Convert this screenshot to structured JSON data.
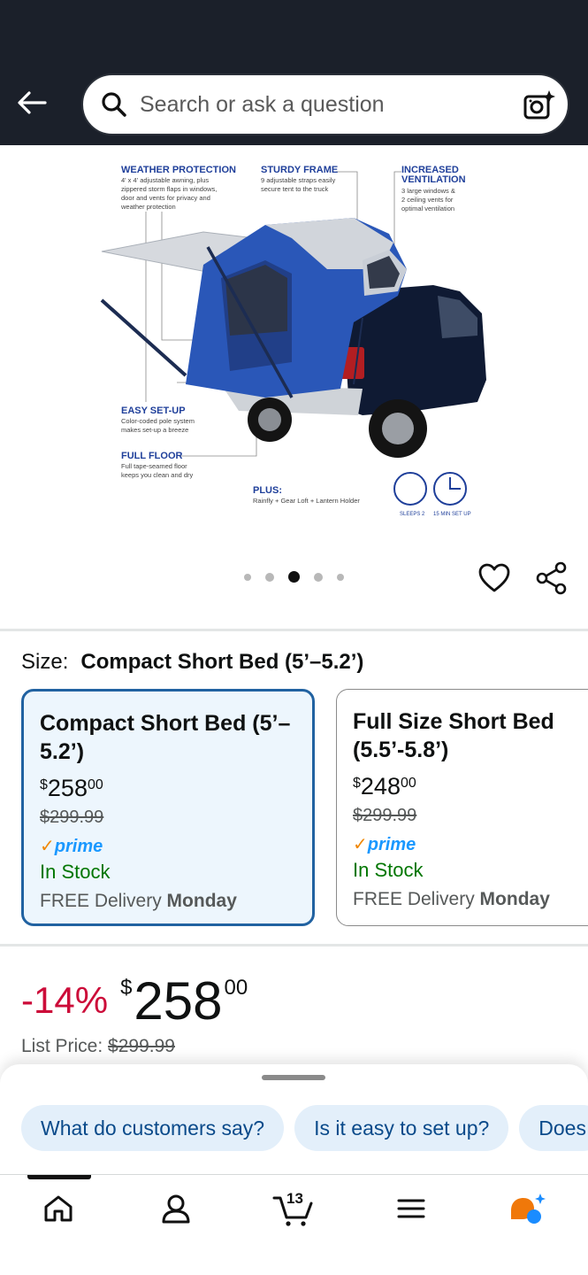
{
  "search": {
    "placeholder": "Search or ask a question"
  },
  "product_image": {
    "callouts": {
      "weather_protection": {
        "title": "WEATHER PROTECTION",
        "text": "4' x 4' adjustable awning, plus zippered storm flaps in windows, door and vents for privacy and weather protection"
      },
      "sturdy_frame": {
        "title": "STURDY FRAME",
        "text": "9 adjustable straps easily secure tent to the truck"
      },
      "increased_ventilation": {
        "title": "INCREASED VENTILATION",
        "text": "3 large windows & 2 ceiling vents for optimal ventilation"
      },
      "easy_setup": {
        "title": "EASY SET-UP",
        "text": "Color-coded pole system makes set-up a breeze"
      },
      "full_floor": {
        "title": "FULL FLOOR",
        "text": "Full tape-seamed floor keeps you clean and dry"
      },
      "plus": {
        "title": "PLUS:",
        "text": "Rainfly + Gear Loft + Lantern Holder"
      },
      "badge_sleeps": "SLEEPS 2",
      "badge_setup": "15 MIN SET UP"
    },
    "carousel": {
      "count": 5,
      "active_index": 2
    }
  },
  "size": {
    "label": "Size:",
    "selected_value": "Compact Short Bed (5’–5.2’)"
  },
  "size_options": [
    {
      "title": "Compact Short Bed (5’–5.2’)",
      "price_symbol": "$",
      "price_whole": "258",
      "price_fraction": "00",
      "list_price": "$299.99",
      "prime": "prime",
      "stock": "In Stock",
      "delivery_prefix": "FREE Delivery",
      "delivery_day": "Monday"
    },
    {
      "title": "Full Size Short Bed (5.5’-5.8’)",
      "price_symbol": "$",
      "price_whole": "248",
      "price_fraction": "00",
      "list_price": "$299.99",
      "prime": "prime",
      "stock": "In Stock",
      "delivery_prefix": "FREE Delivery",
      "delivery_day": "Monday"
    }
  ],
  "price": {
    "discount": "-14%",
    "symbol": "$",
    "whole": "258",
    "fraction": "00",
    "list_label": "List Price:",
    "list_value": "$299.99"
  },
  "suggestions": [
    "What do customers say?",
    "Is it easy to set up?",
    "Does"
  ],
  "nav": {
    "items": [
      "home-icon",
      "account-icon",
      "cart-icon",
      "menu-icon",
      "rufus-icon"
    ],
    "cart_count": "13"
  },
  "colors": {
    "header_bg": "#1b202a",
    "selected_border": "#2162a1",
    "selected_bg": "#edf6fd",
    "discount": "#cc0c39",
    "in_stock": "#007600",
    "prime": "#1a98ff",
    "chip_bg": "#e3effa"
  }
}
